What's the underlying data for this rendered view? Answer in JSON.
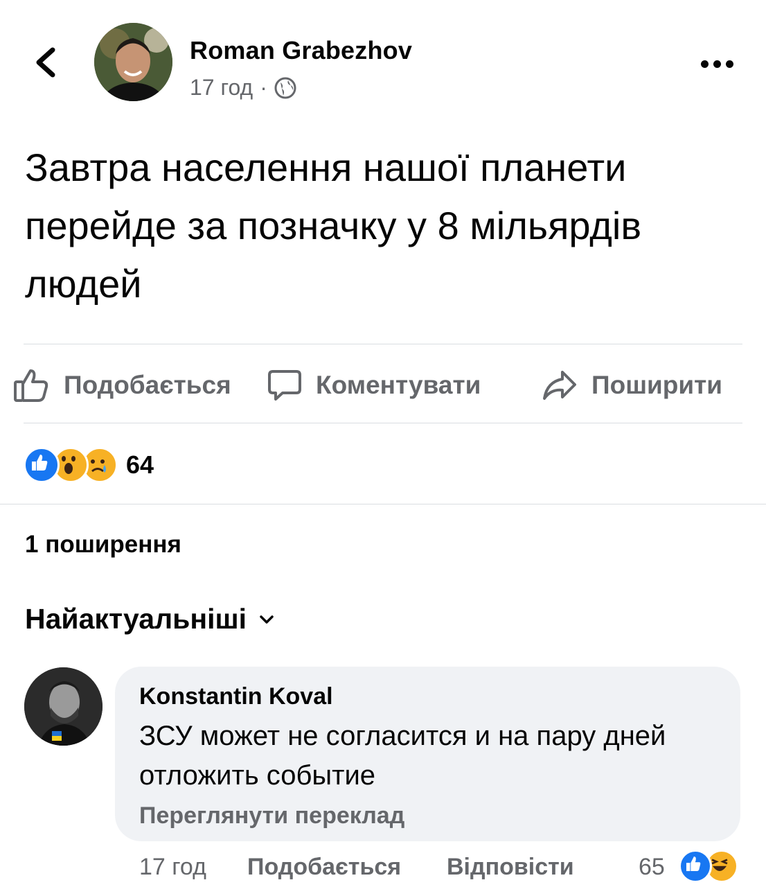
{
  "post": {
    "author": "Roman Grabezhov",
    "time": "17 год",
    "separator": "·",
    "text": "Завтра населення нашої планети перейде за позначку у 8 мільярдів людей"
  },
  "actions": {
    "like_label": "Подобається",
    "comment_label": "Коментувати",
    "share_label": "Поширити"
  },
  "reactions": {
    "icons": [
      "like-icon",
      "wow-icon",
      "sad-icon"
    ],
    "count": "64"
  },
  "shares_text": "1 поширення",
  "sort_label": "Найактуальніші",
  "comment": {
    "author": "Konstantin Koval",
    "text": "ЗСУ может не согласится и на пару дней отложить событие",
    "translate_label": "Переглянути переклад",
    "time": "17 год",
    "like_label": "Подобається",
    "reply_label": "Відповісти",
    "reaction_count": "65",
    "reaction_icons": [
      "like-icon",
      "haha-icon"
    ]
  },
  "colors": {
    "text": "#050505",
    "secondary": "#65676b",
    "bubble": "#f0f2f5",
    "like_blue": "#1877f2",
    "divider": "#dadde1"
  }
}
